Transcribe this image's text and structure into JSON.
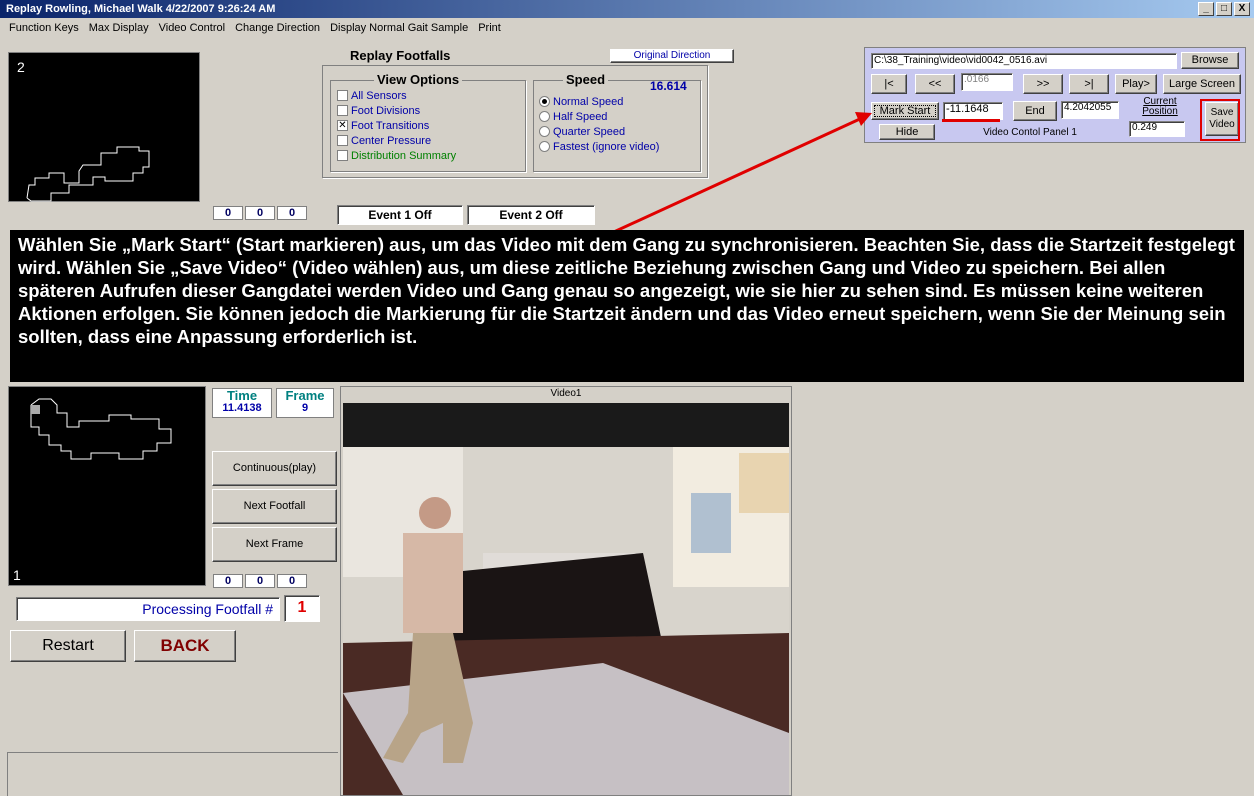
{
  "window": {
    "title": "Replay Rowling, Michael  Walk  4/22/2007 9:26:24 AM",
    "min": "_",
    "max": "□",
    "close": "X"
  },
  "menu": [
    "Function Keys",
    "Max Display",
    "Video Control",
    "Change Direction",
    "Display Normal Gait Sample",
    "Print"
  ],
  "top_left_panel": {
    "number": "2"
  },
  "replay_footfalls": {
    "title": "Replay Footfalls",
    "direction_button": "Original Direction"
  },
  "view_options": {
    "title": "View Options",
    "items": [
      {
        "label": "All Sensors",
        "checked": false
      },
      {
        "label": "Foot Divisions",
        "checked": false
      },
      {
        "label": "Foot Transitions",
        "checked": true
      },
      {
        "label": "Center Pressure",
        "checked": false
      },
      {
        "label": "Distribution Summary",
        "checked": false
      }
    ]
  },
  "speed": {
    "title": "Speed",
    "value": "16.614",
    "options": [
      {
        "label": "Normal Speed",
        "selected": true
      },
      {
        "label": "Half Speed",
        "selected": false
      },
      {
        "label": "Quarter Speed",
        "selected": false
      },
      {
        "label": "Fastest (ignore video)",
        "selected": false
      }
    ]
  },
  "top_counters": [
    "0",
    "0",
    "0"
  ],
  "events": {
    "event1": "Event 1 Off",
    "event2": "Event 2 Off"
  },
  "video_panel": {
    "path": "C:\\38_Training\\video\\vid0042_0516.avi",
    "browse": "Browse",
    "btn_first": "|<",
    "btn_prev": "<<",
    "step_value": ".0166",
    "btn_next": ">>",
    "btn_last": ">|",
    "play": "Play>",
    "large_screen": "Large Screen",
    "mark_start": "Mark Start",
    "start_value": "-11.1648",
    "end": "End",
    "end_value": "4.2042055",
    "current_position_label": "Current Position",
    "current_position": "0.249",
    "save_video": "Save Video",
    "hide": "Hide",
    "panel_label": "Video Contol Panel 1"
  },
  "caption": "Wählen Sie „Mark Start“ (Start markieren) aus, um das Video mit dem Gang zu synchronisieren. Beachten Sie, dass die Startzeit festgelegt wird. Wählen Sie „Save Video“ (Video wählen) aus, um diese zeitliche Beziehung zwischen Gang und Video zu speichern. Bei allen späteren Aufrufen dieser Gangdatei werden Video und Gang genau so angezeigt, wie sie hier zu sehen sind. Es müssen keine weiteren Aktionen erfolgen. Sie können jedoch die Markierung für die Startzeit ändern und das Video erneut speichern, wenn Sie der Meinung sein sollten, dass eine Anpassung erforderlich ist.",
  "bottom_left_panel": {
    "number": "1"
  },
  "time": {
    "label": "Time",
    "value": "11.4138"
  },
  "frame": {
    "label": "Frame",
    "value": "9"
  },
  "buttons": {
    "continuous": "Continuous(play)",
    "next_footfall": "Next Footfall",
    "next_frame": "Next Frame",
    "restart": "Restart",
    "back": "BACK"
  },
  "bottom_counters": [
    "0",
    "0",
    "0"
  ],
  "processing": {
    "label": "Processing Footfall #",
    "value": "1"
  },
  "video_window": {
    "title": "Video1"
  },
  "colors": {
    "accent_red": "#e00000",
    "label_blue": "#0000a8",
    "time_teal": "#008080"
  }
}
